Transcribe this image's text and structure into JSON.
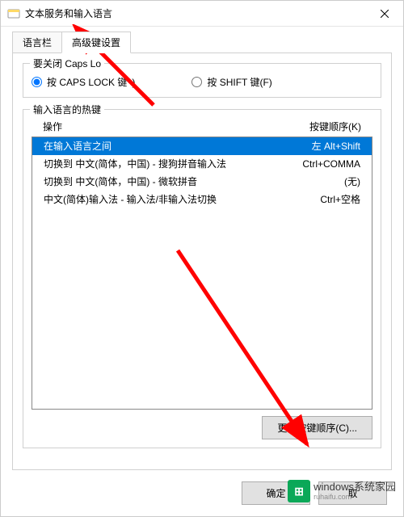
{
  "window": {
    "title": "文本服务和输入语言"
  },
  "tabs": {
    "language_bar": "语言栏",
    "advanced_keys": "高级键设置"
  },
  "capslock": {
    "group_title": "要关闭 Caps Lo",
    "opt_capslock": "按 CAPS LOCK 键",
    "opt_shift": "按 SHIFT 键(F)"
  },
  "hotkeys": {
    "group_title": "输入语言的热键",
    "col_action": "操作",
    "col_keys": "按键顺序(K)",
    "rows": [
      {
        "action": "在输入语言之间",
        "keys": "左 Alt+Shift",
        "selected": true
      },
      {
        "action": "切换到 中文(简体，中国) - 搜狗拼音输入法",
        "keys": "Ctrl+COMMA",
        "selected": false
      },
      {
        "action": "切换到 中文(简体，中国) - 微软拼音",
        "keys": "(无)",
        "selected": false
      },
      {
        "action": "中文(简体)输入法 - 输入法/非输入法切换",
        "keys": "Ctrl+空格",
        "selected": false
      }
    ],
    "change_btn": "更改按键顺序(C)..."
  },
  "buttons": {
    "ok": "确定",
    "cancel": "取"
  },
  "watermark": {
    "line1": "windows系统家园",
    "line2": "ruhaifu.com"
  }
}
